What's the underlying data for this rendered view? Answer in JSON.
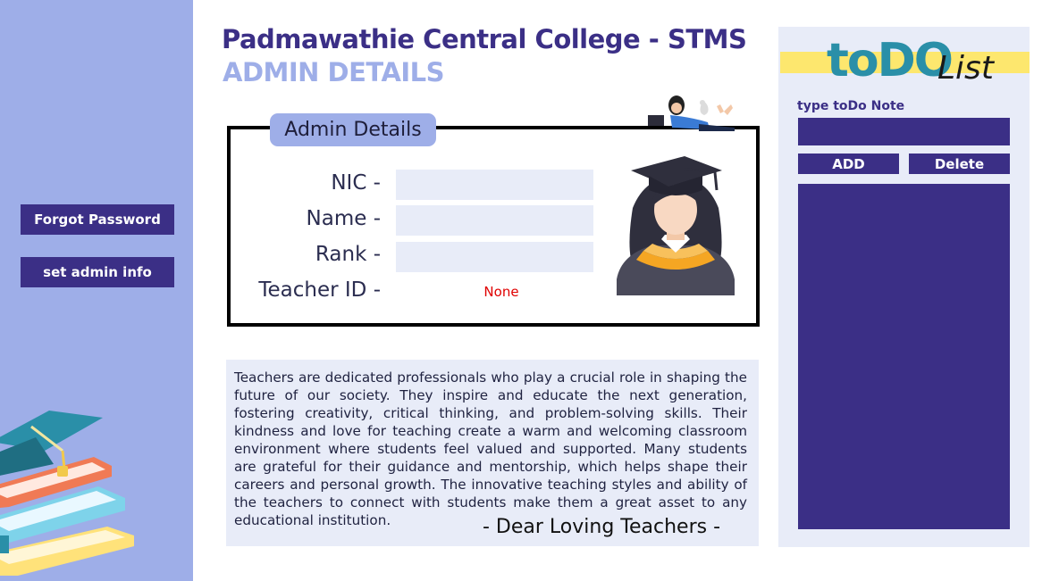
{
  "sidebar": {
    "forgot_password_label": "Forgot Password",
    "set_admin_info_label": "set admin info",
    "background_color": "#9eaee8",
    "illustration_icon": "books-graduation-cap-icon"
  },
  "header": {
    "title": "Padmawathie Central College - STMS",
    "subtitle": "ADMIN DETAILS"
  },
  "admin_card": {
    "legend": "Admin Details",
    "fields": [
      {
        "label": "NIC -",
        "value": ""
      },
      {
        "label": "Name -",
        "value": ""
      },
      {
        "label": "Rank -",
        "value": ""
      }
    ],
    "teacher_id_label": "Teacher ID -",
    "teacher_id_value": "None",
    "avatar_icon": "graduate-avatar-icon",
    "decoration_icon": "reading-girl-icon"
  },
  "quote": {
    "text": "Teachers are dedicated professionals who play a crucial role in shaping the future of our society. They inspire and educate the next generation, fostering creativity, critical thinking, and problem-solving skills. Their kindness and love for teaching create a warm and welcoming classroom environment where students feel valued and supported. Many students are grateful for their guidance and mentorship, which helps shape their careers and personal growth. The innovative teaching styles and ability of the teachers to connect with students make them a great asset to any educational institution.",
    "signature": "- Dear Loving Teachers -"
  },
  "todo": {
    "title_big": "toDO",
    "title_small": "List",
    "note_label": "type toDo Note",
    "note_value": "",
    "add_label": "ADD",
    "delete_label": "Delete",
    "items": []
  },
  "colors": {
    "primary": "#3b2f86",
    "accent": "#9eaee8",
    "highlight": "#fde76e",
    "teal": "#2a8fa8",
    "error": "#e00000"
  }
}
